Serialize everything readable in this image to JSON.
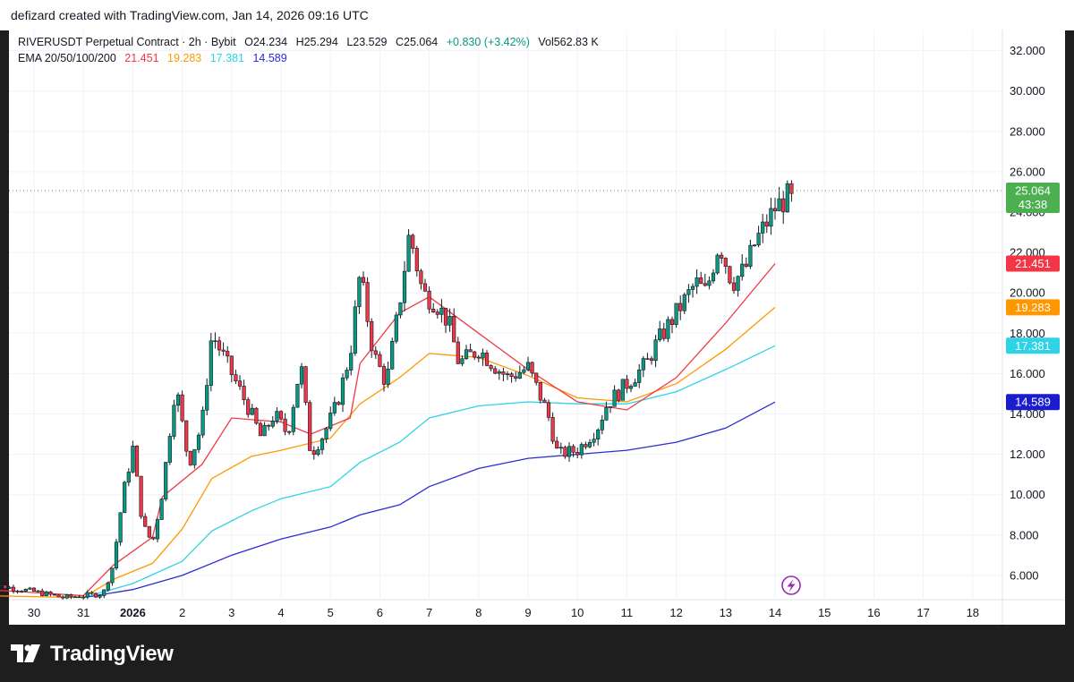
{
  "header": {
    "credit": "defizard created with TradingView.com, Jan 14, 2026 09:16 UTC"
  },
  "legend": {
    "symbol": "RIVERUSDT Perpetual Contract · 2h · Bybit",
    "open": "O24.234",
    "high": "H25.294",
    "low": "L23.529",
    "close": "C25.064",
    "change": "+0.830 (+3.42%)",
    "volume": "Vol562.83 K",
    "ema_label": "EMA 20/50/100/200",
    "ema_values": [
      "21.451",
      "19.283",
      "17.381",
      "14.589"
    ]
  },
  "brand": {
    "name": "TradingView"
  },
  "chart_data": {
    "type": "candlestick",
    "timeframe": "2h",
    "x_ticks": [
      "30",
      "31",
      "2026",
      "2",
      "3",
      "4",
      "5",
      "6",
      "7",
      "8",
      "9",
      "10",
      "11",
      "12",
      "13",
      "14",
      "15",
      "16",
      "17",
      "18"
    ],
    "y_ticks": [
      "6.000",
      "8.000",
      "10.000",
      "12.000",
      "14.000",
      "16.000",
      "18.000",
      "20.000",
      "22.000",
      "24.000",
      "26.000",
      "28.000",
      "30.000",
      "32.000"
    ],
    "ylim": [
      4.8,
      33.0
    ],
    "colors": {
      "up": "#089981",
      "down": "#f23645",
      "ema20": "#f23645",
      "ema50": "#ff9800",
      "ema100": "#2ed3e6",
      "ema200": "#2e2bd4"
    },
    "last_price": {
      "value": "25.064",
      "countdown": "43:38",
      "color": "#4caf50"
    },
    "ema_tags": [
      {
        "name": "EMA 20",
        "value": "21.451",
        "color": "#f23645"
      },
      {
        "name": "EMA 50",
        "value": "19.283",
        "color": "#ff9800"
      },
      {
        "name": "EMA 100",
        "value": "17.381",
        "color": "#2ed3e6"
      },
      {
        "name": "EMA 200",
        "value": "14.589",
        "color": "#1c1ccf"
      }
    ],
    "price_path": [
      [
        "Dec 29",
        5.6
      ],
      [
        "Dec 30",
        5.2
      ],
      [
        "Dec 31",
        4.9
      ],
      [
        "Dec 31",
        5.1
      ],
      [
        "Jan 1",
        6.5
      ],
      [
        "Jan 1",
        10.0
      ],
      [
        "Jan 1",
        12.3
      ],
      [
        "Jan 1",
        8.5
      ],
      [
        "Jan 1",
        7.6
      ],
      [
        "Jan 2",
        10.2
      ],
      [
        "Jan 2",
        15.5
      ],
      [
        "Jan 2",
        11.5
      ],
      [
        "Jan 2",
        13.5
      ],
      [
        "Jan 3",
        18.0
      ],
      [
        "Jan 3",
        16.0
      ],
      [
        "Jan 3",
        14.0
      ],
      [
        "Jan 4",
        12.8
      ],
      [
        "Jan 4",
        14.0
      ],
      [
        "Jan 4",
        13.0
      ],
      [
        "Jan 4",
        16.5
      ],
      [
        "Jan 5",
        12.0
      ],
      [
        "Jan 5",
        13.0
      ],
      [
        "Jan 5",
        14.5
      ],
      [
        "Jan 5",
        17.0
      ],
      [
        "Jan 6",
        21.0
      ],
      [
        "Jan 6",
        17.0
      ],
      [
        "Jan 6",
        15.5
      ],
      [
        "Jan 6",
        19.5
      ],
      [
        "Jan 7",
        23.0
      ],
      [
        "Jan 7",
        20.0
      ],
      [
        "Jan 7",
        19.5
      ],
      [
        "Jan 7",
        18.5
      ],
      [
        "Jan 8",
        16.5
      ],
      [
        "Jan 8",
        17.2
      ],
      [
        "Jan 8",
        16.2
      ],
      [
        "Jan 9",
        15.8
      ],
      [
        "Jan 9",
        16.3
      ],
      [
        "Jan 9",
        14.0
      ],
      [
        "Jan 10",
        12.0
      ],
      [
        "Jan 10",
        12.2
      ],
      [
        "Jan 10",
        13.3
      ],
      [
        "Jan 11",
        14.5
      ],
      [
        "Jan 11",
        15.5
      ],
      [
        "Jan 11",
        16.5
      ],
      [
        "Jan 12",
        17.5
      ],
      [
        "Jan 12",
        19.0
      ],
      [
        "Jan 12",
        20.5
      ],
      [
        "Jan 13",
        20.0
      ],
      [
        "Jan 13",
        22.5
      ],
      [
        "Jan 13",
        20.5
      ],
      [
        "Jan 13",
        21.2
      ],
      [
        "Jan 14",
        22.5
      ],
      [
        "Jan 14",
        24.2
      ],
      [
        "Jan 14",
        25.064
      ]
    ],
    "ema20_path": [
      [
        "Dec 29",
        5.3
      ],
      [
        "Dec 31",
        5.0
      ],
      [
        "Jan 1",
        6.5
      ],
      [
        "Jan 1",
        7.9
      ],
      [
        "Jan 2",
        9.9
      ],
      [
        "Jan 2",
        11.5
      ],
      [
        "Jan 3",
        13.8
      ],
      [
        "Jan 4",
        13.6
      ],
      [
        "Jan 5",
        13.0
      ],
      [
        "Jan 5",
        13.8
      ],
      [
        "Jan 6",
        16.5
      ],
      [
        "Jan 6",
        19.0
      ],
      [
        "Jan 7",
        19.8
      ],
      [
        "Jan 8",
        18.0
      ],
      [
        "Jan 9",
        16.2
      ],
      [
        "Jan 10",
        14.6
      ],
      [
        "Jan 11",
        14.2
      ],
      [
        "Jan 12",
        15.8
      ],
      [
        "Jan 13",
        18.5
      ],
      [
        "Jan 14",
        21.451
      ]
    ],
    "ema50_path": [
      [
        "Dec 29",
        5.0
      ],
      [
        "Dec 31",
        4.9
      ],
      [
        "Jan 1",
        5.8
      ],
      [
        "Jan 1",
        6.6
      ],
      [
        "Jan 2",
        8.3
      ],
      [
        "Jan 3",
        10.8
      ],
      [
        "Jan 3",
        11.9
      ],
      [
        "Jan 4",
        12.2
      ],
      [
        "Jan 5",
        12.8
      ],
      [
        "Jan 6",
        14.5
      ],
      [
        "Jan 6",
        15.8
      ],
      [
        "Jan 7",
        17.0
      ],
      [
        "Jan 8",
        16.8
      ],
      [
        "Jan 9",
        15.9
      ],
      [
        "Jan 10",
        14.8
      ],
      [
        "Jan 11",
        14.6
      ],
      [
        "Jan 12",
        15.5
      ],
      [
        "Jan 13",
        17.2
      ],
      [
        "Jan 14",
        19.283
      ]
    ],
    "ema100_path": [
      [
        "Dec 31",
        4.9
      ],
      [
        "Jan 1",
        5.6
      ],
      [
        "Jan 2",
        6.7
      ],
      [
        "Jan 3",
        8.2
      ],
      [
        "Jan 3",
        9.2
      ],
      [
        "Jan 4",
        9.8
      ],
      [
        "Jan 5",
        10.4
      ],
      [
        "Jan 6",
        11.6
      ],
      [
        "Jan 6",
        12.6
      ],
      [
        "Jan 7",
        13.8
      ],
      [
        "Jan 8",
        14.4
      ],
      [
        "Jan 9",
        14.6
      ],
      [
        "Jan 10",
        14.5
      ],
      [
        "Jan 11",
        14.5
      ],
      [
        "Jan 12",
        15.1
      ],
      [
        "Jan 13",
        16.2
      ],
      [
        "Jan 14",
        17.381
      ]
    ],
    "ema200_path": [
      [
        "Dec 31",
        4.9
      ],
      [
        "Jan 1",
        5.3
      ],
      [
        "Jan 2",
        6.0
      ],
      [
        "Jan 3",
        7.0
      ],
      [
        "Jan 4",
        7.8
      ],
      [
        "Jan 5",
        8.4
      ],
      [
        "Jan 6",
        9.0
      ],
      [
        "Jan 6",
        9.5
      ],
      [
        "Jan 7",
        10.4
      ],
      [
        "Jan 8",
        11.3
      ],
      [
        "Jan 9",
        11.8
      ],
      [
        "Jan 10",
        12.0
      ],
      [
        "Jan 11",
        12.2
      ],
      [
        "Jan 12",
        12.6
      ],
      [
        "Jan 13",
        13.3
      ],
      [
        "Jan 14",
        14.589
      ]
    ]
  }
}
